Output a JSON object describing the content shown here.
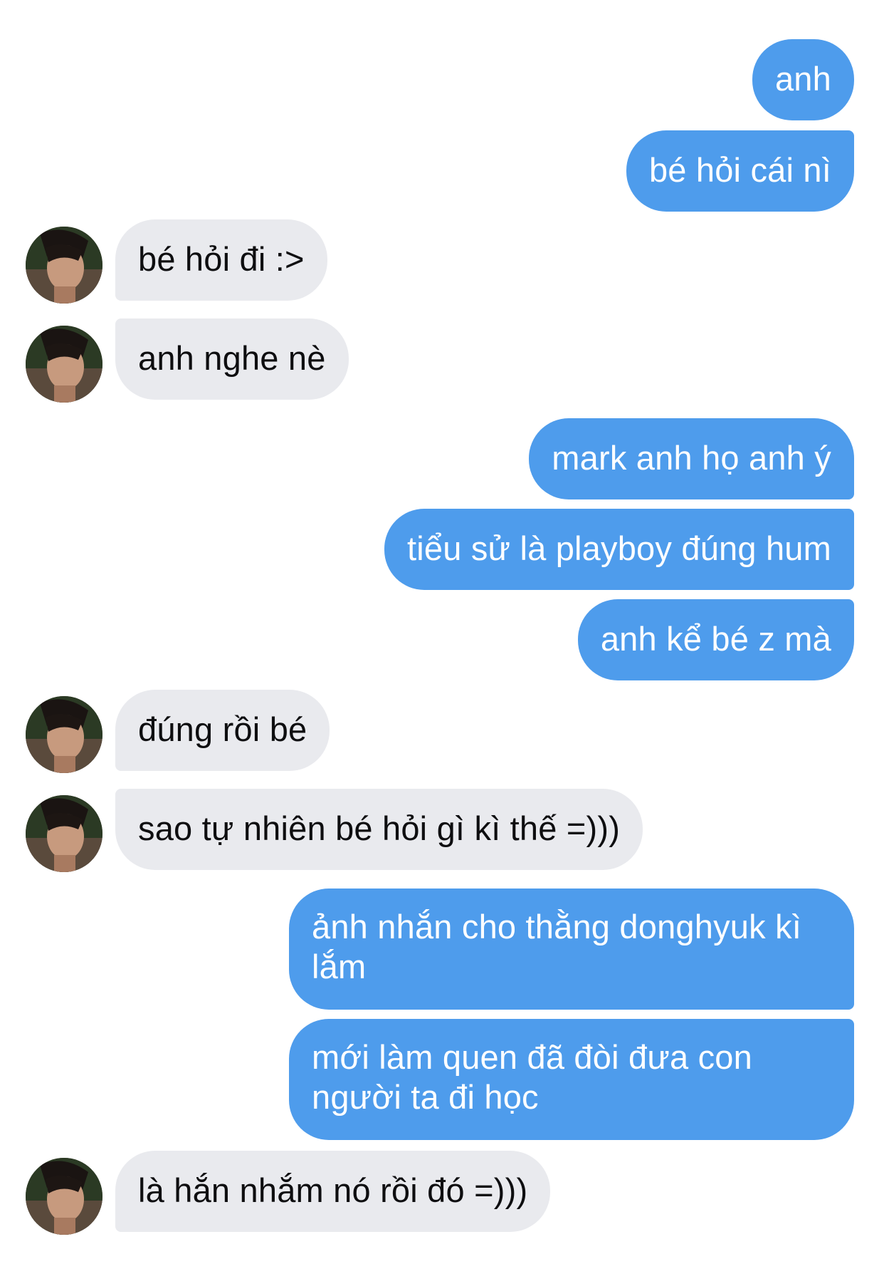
{
  "conversation": {
    "messages": [
      {
        "from": "me",
        "text": "anh"
      },
      {
        "from": "me",
        "text": "bé hỏi cái nì"
      },
      {
        "from": "them",
        "text": "bé hỏi đi :>"
      },
      {
        "from": "them",
        "text": "anh nghe nè"
      },
      {
        "from": "me",
        "text": "mark anh họ anh ý"
      },
      {
        "from": "me",
        "text": "tiểu sử là playboy đúng hum"
      },
      {
        "from": "me",
        "text": "anh kể bé z mà"
      },
      {
        "from": "them",
        "text": "đúng rồi bé"
      },
      {
        "from": "them",
        "text": "sao tự nhiên bé hỏi gì kì thế =)))"
      },
      {
        "from": "me",
        "text": "ảnh nhắn cho thằng donghyuk kì lắm"
      },
      {
        "from": "me",
        "text": "mới làm quen đã đòi đưa con người ta đi học"
      },
      {
        "from": "them",
        "text": "là hắn nhắm nó rồi đó =)))"
      }
    ]
  },
  "colors": {
    "sent_bubble": "#4e9cec",
    "received_bubble": "#e9eaee",
    "sent_text": "#ffffff",
    "received_text": "#0e0e10"
  }
}
